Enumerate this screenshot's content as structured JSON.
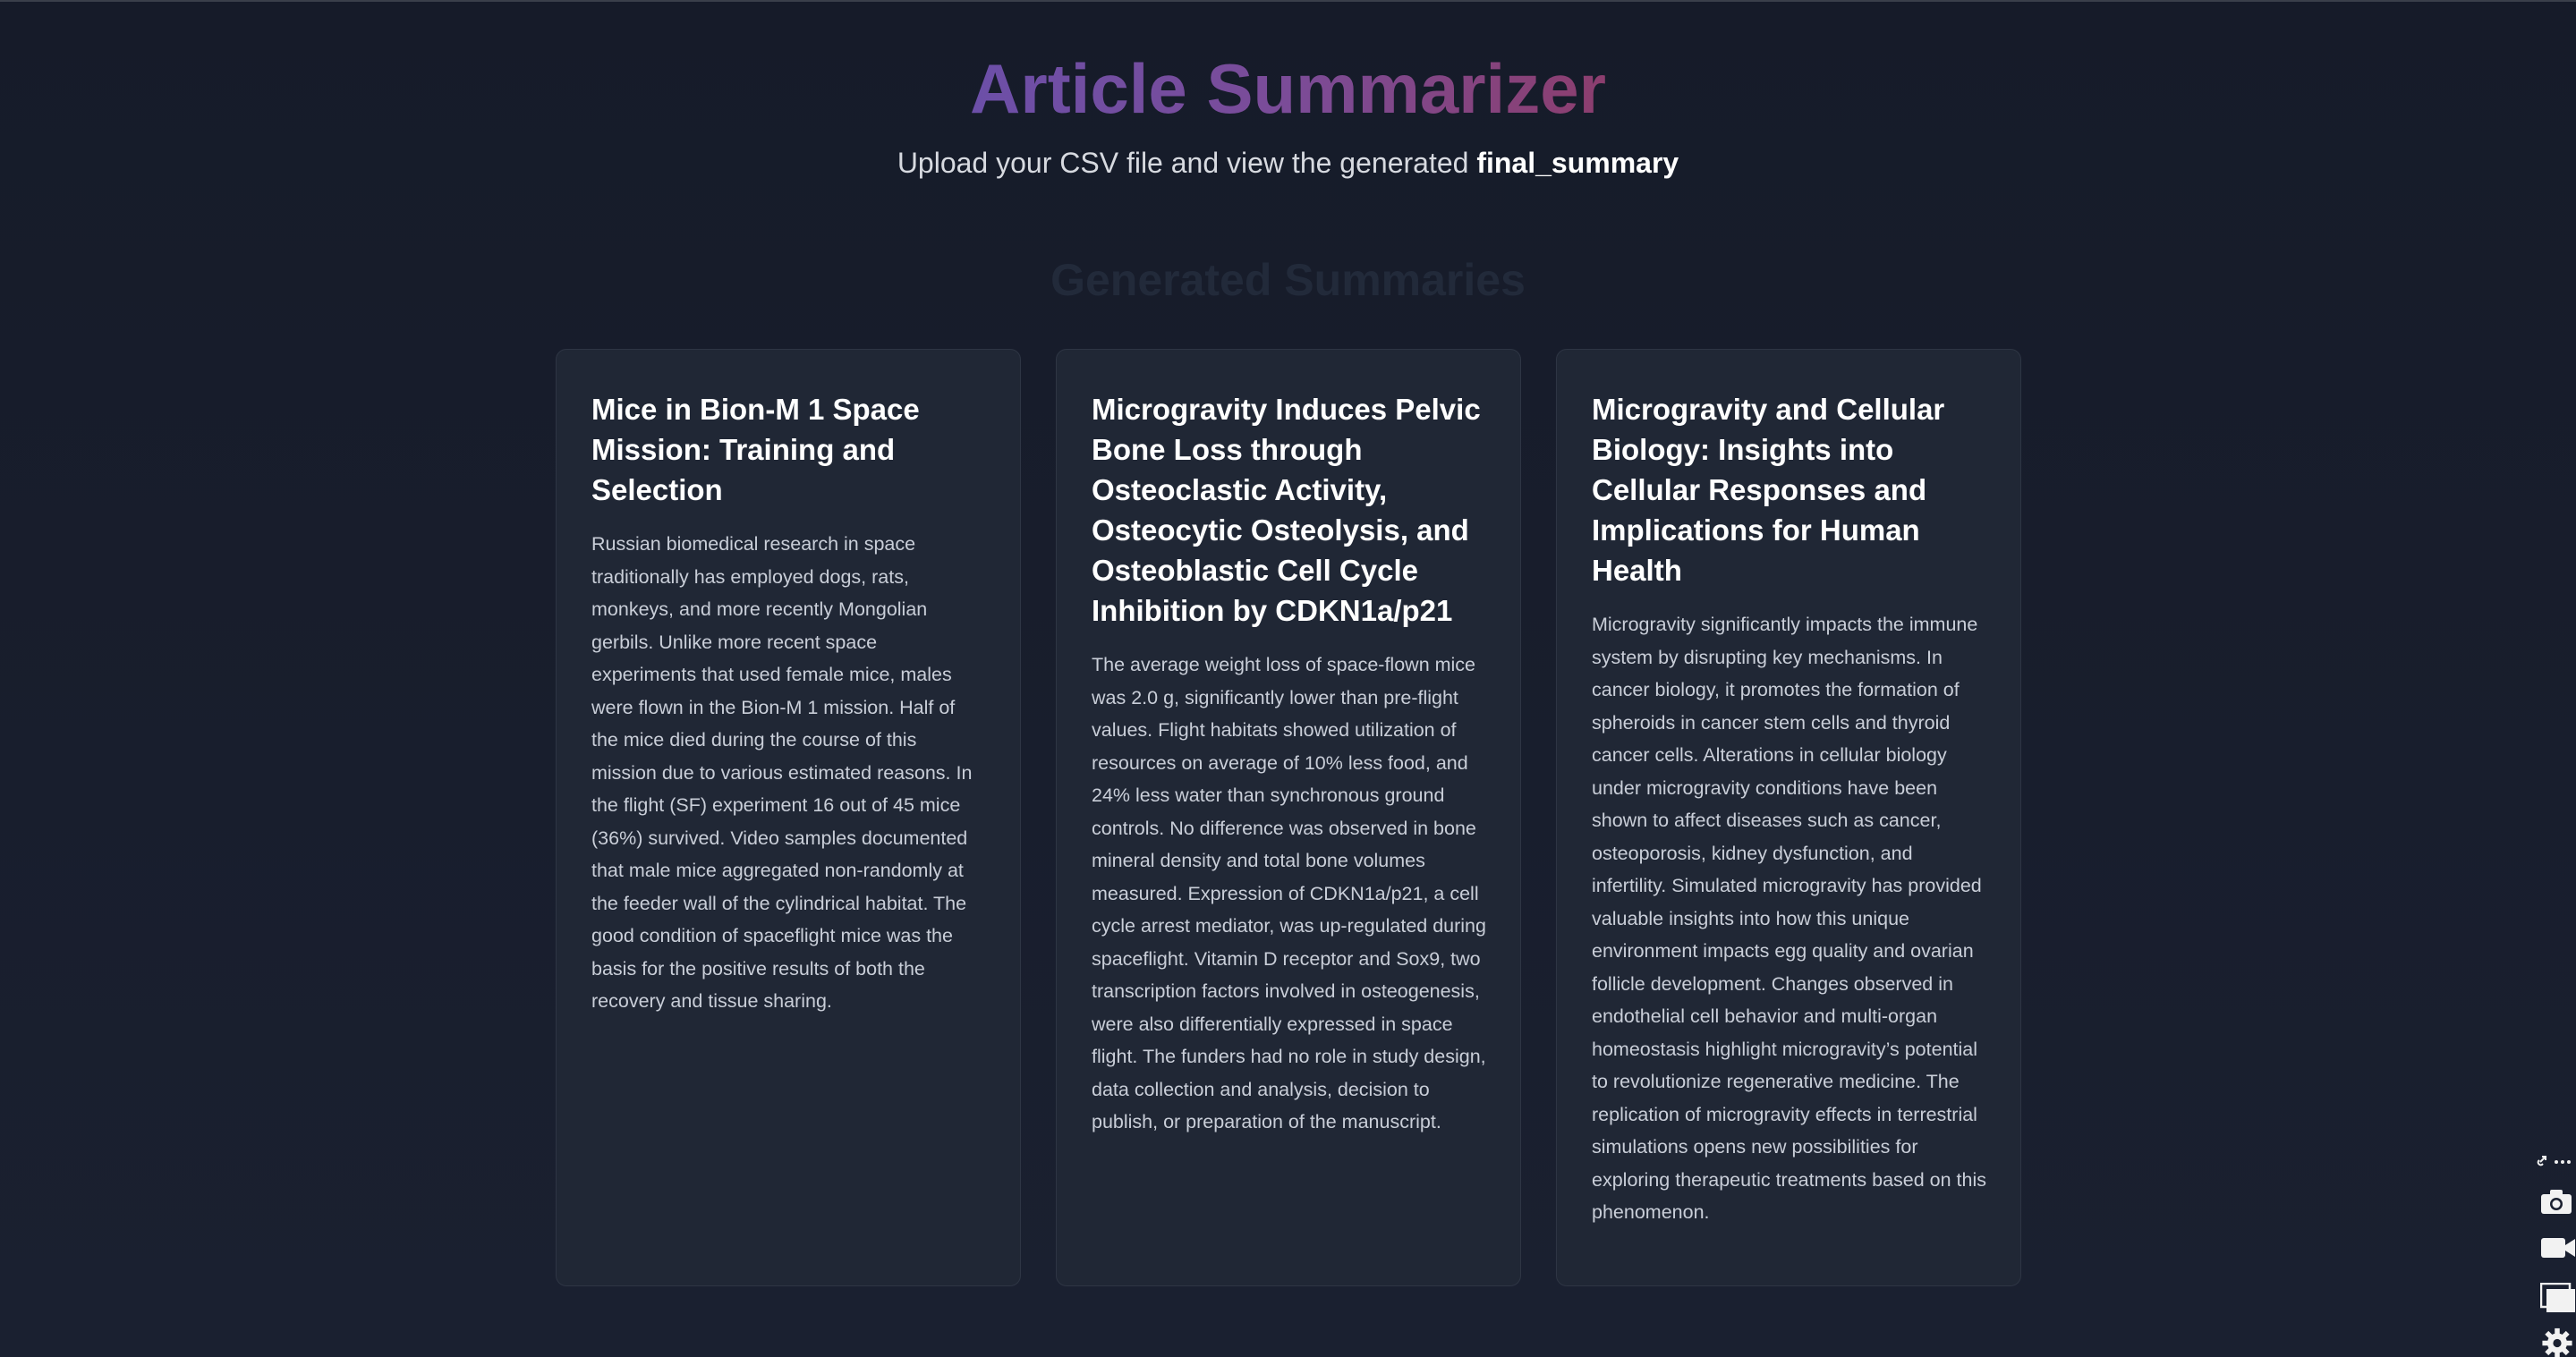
{
  "header": {
    "title": "Article Summarizer",
    "subtitle_prefix": "Upload your CSV file and view the generated ",
    "subtitle_bold": "final_summary"
  },
  "section": {
    "heading": "Generated Summaries"
  },
  "cards": [
    {
      "title": "Mice in Bion-M 1 Space Mission: Training and Selection",
      "summary": "Russian biomedical research in space traditionally has employed dogs, rats, monkeys, and more recently Mongolian gerbils. Unlike more recent space experiments that used female mice, males were flown in the Bion-M 1 mission. Half of the mice died during the course of this mission due to various estimated reasons. In the flight (SF) experiment 16 out of 45 mice (36%) survived. Video samples documented that male mice aggregated non-randomly at the feeder wall of the cylindrical habitat. The good condition of spaceflight mice was the basis for the positive results of both the recovery and tissue sharing."
    },
    {
      "title": "Microgravity Induces Pelvic Bone Loss through Osteoclastic Activity, Osteocytic Osteolysis, and Osteoblastic Cell Cycle Inhibition by CDKN1a/p21",
      "summary": "The average weight loss of space-flown mice was 2.0 g, significantly lower than pre-flight values. Flight habitats showed utilization of resources on average of 10% less food, and 24% less water than synchronous ground controls. No difference was observed in bone mineral density and total bone volumes measured. Expression of CDKN1a/p21, a cell cycle arrest mediator, was up-regulated during spaceflight. Vitamin D receptor and Sox9, two transcription factors involved in osteogenesis, were also differentially expressed in space flight. The funders had no role in study design, data collection and analysis, decision to publish, or preparation of the manuscript."
    },
    {
      "title": "Microgravity and Cellular Biology: Insights into Cellular Responses and Implications for Human Health",
      "summary": "Microgravity significantly impacts the immune system by disrupting key mechanisms. In cancer biology, it promotes the formation of spheroids in cancer stem cells and thyroid cancer cells. Alterations in cellular biology under microgravity conditions have been shown to affect diseases such as cancer, osteoporosis, kidney dysfunction, and infertility. Simulated microgravity has provided valuable insights into how this unique environment impacts egg quality and ovarian follicle development. Changes observed in endothelial cell behavior and multi-organ homeostasis highlight microgravity’s potential to revolutionize regenerative medicine. The replication of microgravity effects in terrestrial simulations opens new possibilities for exploring therapeutic treatments based on this phenomenon."
    }
  ],
  "toolbar": {
    "icons": [
      "link-more-icon",
      "camera-icon",
      "video-icon",
      "window-icon",
      "gear-icon"
    ]
  },
  "colors": {
    "background": "#171c2a",
    "card": "#202735",
    "title_gradient_start": "#6c4fa8",
    "title_gradient_end": "#8c3e6e"
  }
}
